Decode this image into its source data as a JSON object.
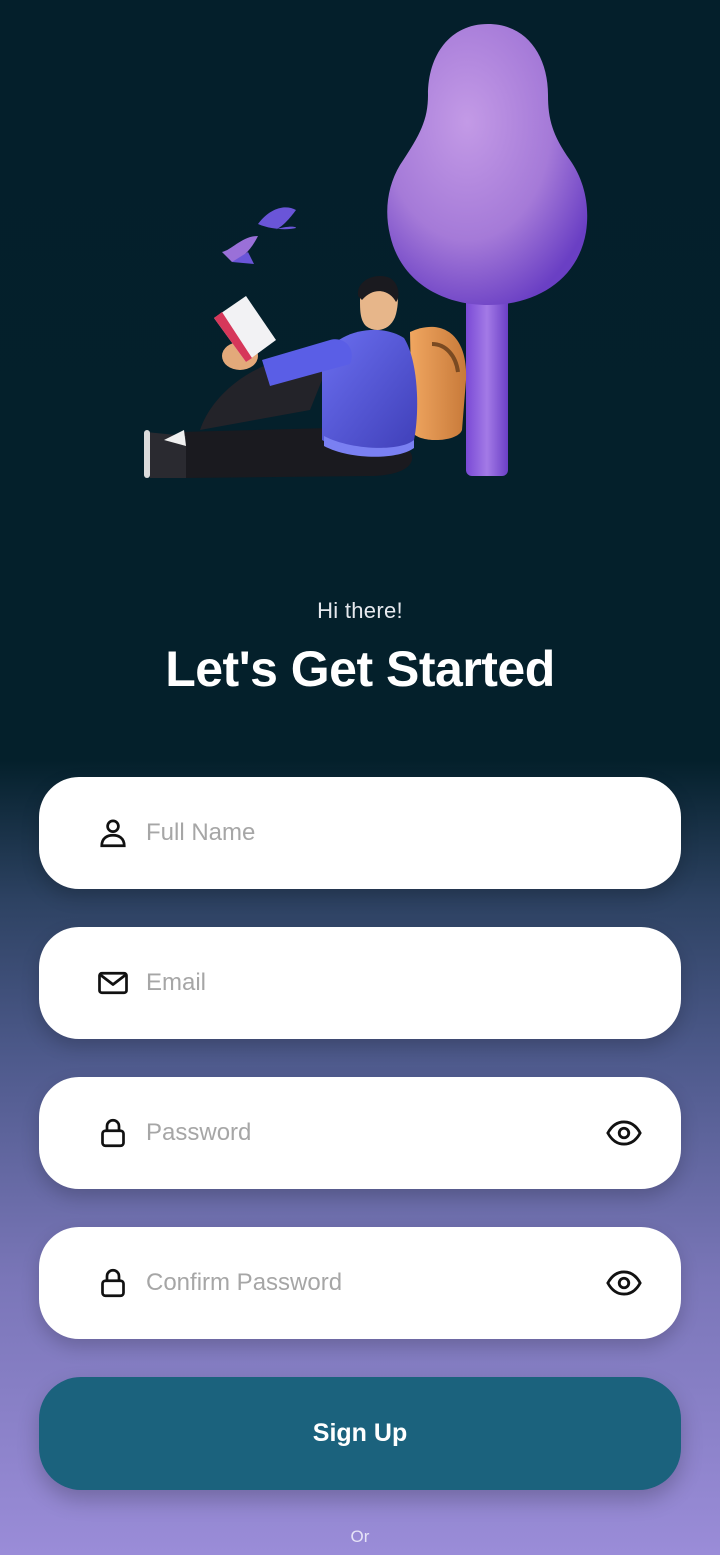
{
  "header": {
    "greeting": "Hi there!",
    "title": "Let's Get Started"
  },
  "form": {
    "full_name": {
      "placeholder": "Full Name",
      "value": "",
      "icon": "person-icon"
    },
    "email": {
      "placeholder": "Email",
      "value": "",
      "icon": "mail-icon"
    },
    "password": {
      "placeholder": "Password",
      "value": "",
      "icon": "lock-icon",
      "toggle_icon": "eye-icon"
    },
    "confirm_password": {
      "placeholder": "Confirm Password",
      "value": "",
      "icon": "lock-icon",
      "toggle_icon": "eye-icon"
    },
    "submit_label": "Sign Up"
  },
  "footer": {
    "divider_text": "Or"
  },
  "colors": {
    "background_top": "#041f2b",
    "background_bottom": "#9a8cd8",
    "primary_button": "#1b627d",
    "field_background": "#ffffff",
    "placeholder": "#a6a6a6"
  }
}
